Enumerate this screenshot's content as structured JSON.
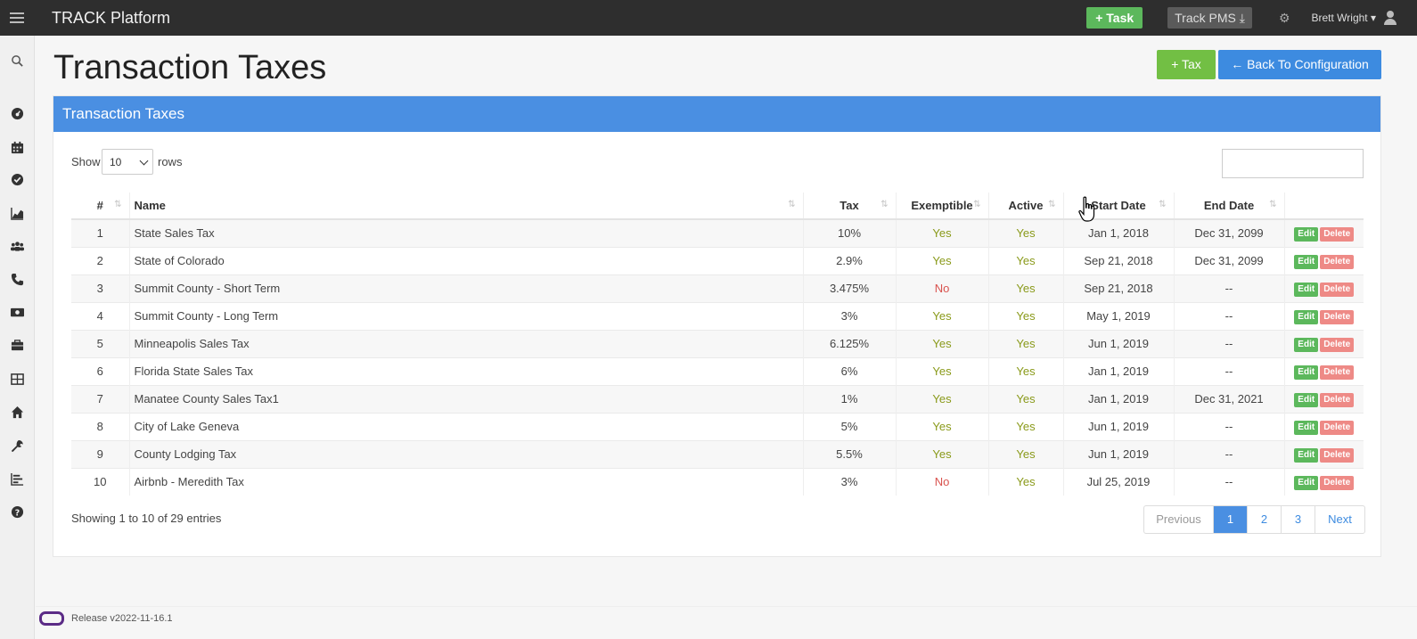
{
  "app": {
    "title": "TRACK Platform"
  },
  "topbar": {
    "task_label": "+ Task",
    "track_pms_label": "Track PMS ⤓",
    "user_name": "Brett Wright ▾"
  },
  "page": {
    "title": "Transaction Taxes",
    "add_tax_label": "+ Tax",
    "back_label": "← Back To Configuration"
  },
  "panel": {
    "title": "Transaction Taxes"
  },
  "controls": {
    "show_label": "Show",
    "rows_value": "10",
    "rows_label": "rows",
    "search_value": ""
  },
  "table": {
    "headers": [
      "#",
      "Name",
      "Tax",
      "Exemptible",
      "Active",
      "Start Date",
      "End Date"
    ],
    "rows": [
      {
        "num": "1",
        "name": "State Sales Tax",
        "tax": "10%",
        "exemptible": "Yes",
        "active": "Yes",
        "start": "Jan 1, 2018",
        "end": "Dec 31, 2099"
      },
      {
        "num": "2",
        "name": "State of Colorado",
        "tax": "2.9%",
        "exemptible": "Yes",
        "active": "Yes",
        "start": "Sep 21, 2018",
        "end": "Dec 31, 2099"
      },
      {
        "num": "3",
        "name": "Summit County - Short Term",
        "tax": "3.475%",
        "exemptible": "No",
        "active": "Yes",
        "start": "Sep 21, 2018",
        "end": "--"
      },
      {
        "num": "4",
        "name": "Summit County - Long Term",
        "tax": "3%",
        "exemptible": "Yes",
        "active": "Yes",
        "start": "May 1, 2019",
        "end": "--"
      },
      {
        "num": "5",
        "name": "Minneapolis Sales Tax",
        "tax": "6.125%",
        "exemptible": "Yes",
        "active": "Yes",
        "start": "Jun 1, 2019",
        "end": "--"
      },
      {
        "num": "6",
        "name": "Florida State Sales Tax",
        "tax": "6%",
        "exemptible": "Yes",
        "active": "Yes",
        "start": "Jan 1, 2019",
        "end": "--"
      },
      {
        "num": "7",
        "name": "Manatee County Sales Tax1",
        "tax": "1%",
        "exemptible": "Yes",
        "active": "Yes",
        "start": "Jan 1, 2019",
        "end": "Dec 31, 2021"
      },
      {
        "num": "8",
        "name": "City of Lake Geneva",
        "tax": "5%",
        "exemptible": "Yes",
        "active": "Yes",
        "start": "Jun 1, 2019",
        "end": "--"
      },
      {
        "num": "9",
        "name": "County Lodging Tax",
        "tax": "5.5%",
        "exemptible": "Yes",
        "active": "Yes",
        "start": "Jun 1, 2019",
        "end": "--"
      },
      {
        "num": "10",
        "name": "Airbnb - Meredith Tax",
        "tax": "3%",
        "exemptible": "No",
        "active": "Yes",
        "start": "Jul 25, 2019",
        "end": "--"
      }
    ],
    "edit_label": "Edit",
    "delete_label": "Delete"
  },
  "info": {
    "text": "Showing 1 to 10 of 29 entries"
  },
  "pagination": {
    "previous": "Previous",
    "pages": [
      "1",
      "2",
      "3"
    ],
    "next": "Next",
    "current": "1"
  },
  "footer": {
    "release": "Release v2022-11-16.1"
  },
  "colors": {
    "topbar": "#2e2e2e",
    "panel_header": "#4a8fe2",
    "green": "#72bf44",
    "blue": "#3d8be0"
  },
  "sidebar_icons": [
    "search-icon",
    "dashboard-icon",
    "calendar-icon",
    "check-circle-icon",
    "chart-icon",
    "users-icon",
    "phone-icon",
    "money-icon",
    "briefcase-icon",
    "grid-icon",
    "home-icon",
    "wrench-icon",
    "report-icon",
    "help-icon"
  ]
}
